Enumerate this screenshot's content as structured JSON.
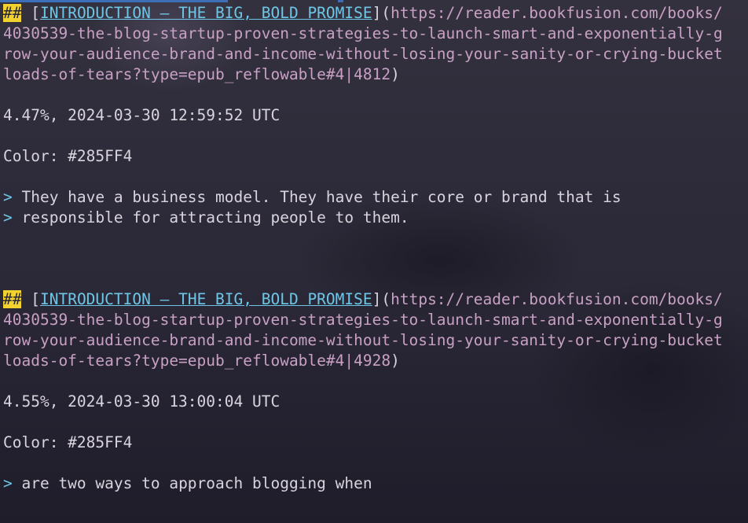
{
  "entries": [
    {
      "heading_marker": "##",
      "title": "INTRODUCTION – THE BIG, BOLD PROMISE",
      "url_lines": [
        "https://reader.bookfusion.com/books/",
        "4030539-the-blog-startup-proven-strategies-to-launch-smart-and-exponentially-g",
        "row-your-audience-brand-and-income-without-losing-your-sanity-or-crying-bucket",
        "loads-of-tears?type=epub_reflowable#4|4812"
      ],
      "meta": "4.47%, 2024-03-30 12:59:52 UTC",
      "color_line": "Color: #285FF4",
      "quote_lines": [
        "They have a business model. They have their core or brand that is",
        "responsible for attracting people to them."
      ]
    },
    {
      "heading_marker": "##",
      "title": "INTRODUCTION – THE BIG, BOLD PROMISE",
      "url_lines": [
        "https://reader.bookfusion.com/books/",
        "4030539-the-blog-startup-proven-strategies-to-launch-smart-and-exponentially-g",
        "row-your-audience-brand-and-income-without-losing-your-sanity-or-crying-bucket",
        "loads-of-tears?type=epub_reflowable#4|4928"
      ],
      "meta": "4.55%, 2024-03-30 13:00:04 UTC",
      "color_line": "Color: #285FF4",
      "quote_lines": [
        "are two ways to approach blogging when"
      ]
    }
  ],
  "symbols": {
    "open_bracket": "[",
    "close_bracket_paren": "](",
    "close_paren": ")",
    "quote_marker": "> "
  },
  "colors": {
    "heading_marker_bg": "#f2d22e",
    "link": "#6ec6e6",
    "url": "#c8a0c4",
    "text": "#d9d4de",
    "background": "#2a2838"
  }
}
